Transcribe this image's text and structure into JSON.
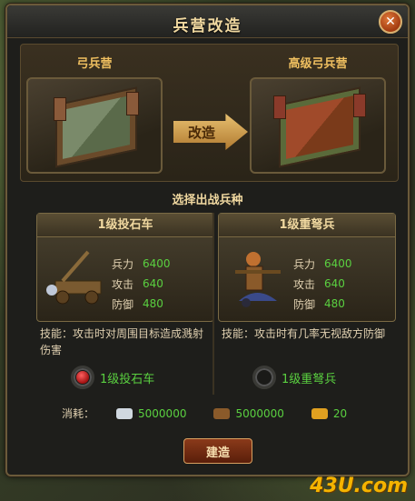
{
  "window": {
    "title": "兵营改造",
    "close_glyph": "✕"
  },
  "upgrade": {
    "from_label": "弓兵营",
    "to_label": "高级弓兵营",
    "arrow_label": "改造"
  },
  "section_title": "选择出战兵种",
  "units": [
    {
      "name": "1级投石车",
      "stats": [
        {
          "label": "兵力",
          "value": "6400"
        },
        {
          "label": "攻击",
          "value": "640"
        },
        {
          "label": "防御",
          "value": "480"
        }
      ],
      "skill_text": "技能：攻击时对周围目标造成溅射伤害",
      "select_label": "1级投石车",
      "selected": true,
      "icon": "catapult-icon"
    },
    {
      "name": "1级重弩兵",
      "stats": [
        {
          "label": "兵力",
          "value": "6400"
        },
        {
          "label": "攻击",
          "value": "640"
        },
        {
          "label": "防御",
          "value": "480"
        }
      ],
      "skill_text": "技能：攻击时有几率无视敌方防御",
      "select_label": "1级重弩兵",
      "selected": false,
      "icon": "crossbowman-icon"
    }
  ],
  "cost": {
    "label": "消耗：",
    "silver": "5000000",
    "wood": "5000000",
    "gold": "20"
  },
  "build_button": "建造",
  "watermark": "43U.com",
  "colors": {
    "accent_gold": "#f0c060",
    "value_green": "#5ad040",
    "button_red": "#8a3a1a"
  }
}
